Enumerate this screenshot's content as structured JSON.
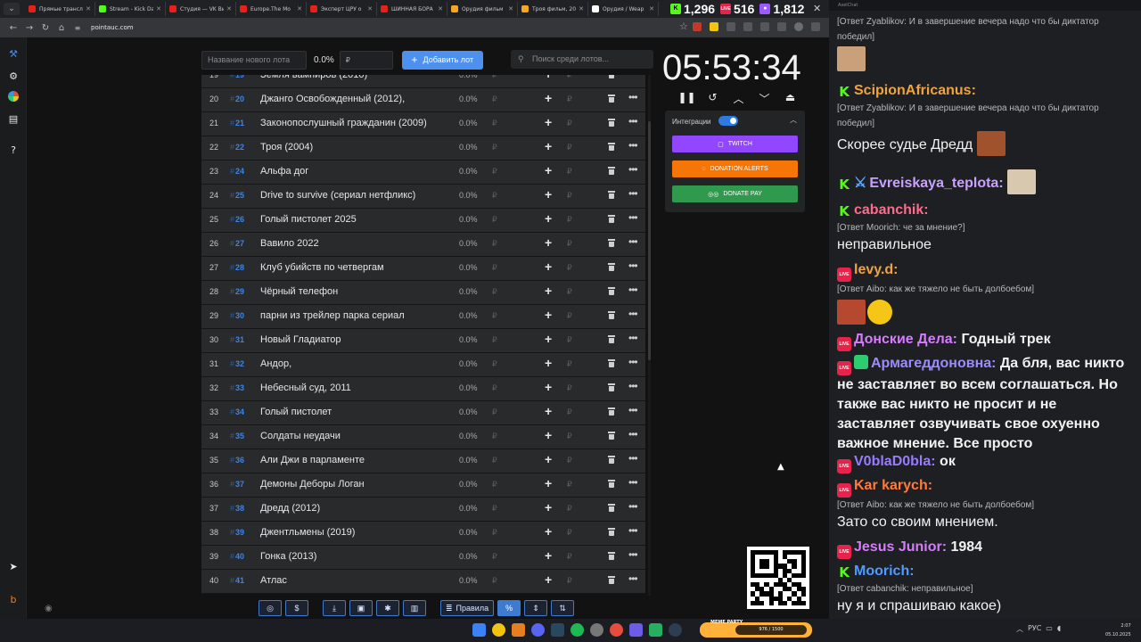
{
  "browser": {
    "tabs": [
      {
        "label": "Прямые трансл",
        "color": "#e62117"
      },
      {
        "label": "Stream - Kick Da",
        "color": "#53fc18"
      },
      {
        "label": "Студия — VK Ви",
        "color": "#e62117"
      },
      {
        "label": "Europe.The Mo",
        "color": "#e62117"
      },
      {
        "label": "Эксперт ЦРУ о",
        "color": "#e62117"
      },
      {
        "label": "ШИННАЯ БОРА",
        "color": "#e62117"
      },
      {
        "label": "Орудия фильм",
        "color": "#f5a623"
      },
      {
        "label": "Троя фильм, 20",
        "color": "#f5a623"
      },
      {
        "label": "Орудия / Weap",
        "color": "#ffffff"
      }
    ],
    "url": "pointauc.com",
    "viewer_stats": [
      {
        "platform": "K",
        "count": "1,296",
        "color": "#53fc18"
      },
      {
        "platform": "LIVE",
        "count": "516",
        "color": "#e6244b"
      },
      {
        "platform": "",
        "count": "1,812",
        "color": "#9b59ff"
      }
    ]
  },
  "auction": {
    "new_lot_placeholder": "Название нового лота",
    "percent": "0.0%",
    "currency_placeholder": "₽",
    "add_button": "Добавить лот",
    "search_placeholder": "Поиск среди лотов...",
    "top_partial_row": {
      "num": "19",
      "id": "19",
      "name": "Земля вампиров (2010)"
    },
    "rows": [
      {
        "num": "20",
        "id": "20",
        "name": "Джанго Освобожденный (2012),",
        "pct": "0.0%"
      },
      {
        "num": "21",
        "id": "21",
        "name": "Законопослушный гражданин (2009)",
        "pct": "0.0%"
      },
      {
        "num": "22",
        "id": "22",
        "name": "Троя (2004)",
        "pct": "0.0%"
      },
      {
        "num": "23",
        "id": "24",
        "name": "Альфа дог",
        "pct": "0.0%"
      },
      {
        "num": "24",
        "id": "25",
        "name": "Drive to survive (сериал нетфликс)",
        "pct": "0.0%"
      },
      {
        "num": "25",
        "id": "26",
        "name": "Голый пистолет 2025",
        "pct": "0.0%"
      },
      {
        "num": "26",
        "id": "27",
        "name": "Вавило 2022",
        "pct": "0.0%"
      },
      {
        "num": "27",
        "id": "28",
        "name": "Клуб убийств по четвергам",
        "pct": "0.0%"
      },
      {
        "num": "28",
        "id": "29",
        "name": "Чёрный телефон",
        "pct": "0.0%"
      },
      {
        "num": "29",
        "id": "30",
        "name": "парни из трейлер парка сериал",
        "pct": "0.0%"
      },
      {
        "num": "30",
        "id": "31",
        "name": "Новый Гладиатор",
        "pct": "0.0%"
      },
      {
        "num": "31",
        "id": "32",
        "name": "Андор,",
        "pct": "0.0%"
      },
      {
        "num": "32",
        "id": "33",
        "name": "Небесный суд, 2011",
        "pct": "0.0%"
      },
      {
        "num": "33",
        "id": "34",
        "name": "Голый пистолет",
        "pct": "0.0%"
      },
      {
        "num": "34",
        "id": "35",
        "name": "Солдаты неудачи",
        "pct": "0.0%"
      },
      {
        "num": "35",
        "id": "36",
        "name": "Али Джи в парламенте",
        "pct": "0.0%"
      },
      {
        "num": "36",
        "id": "37",
        "name": "Демоны Деборы Логан",
        "pct": "0.0%"
      },
      {
        "num": "37",
        "id": "38",
        "name": "Дредд (2012)",
        "pct": "0.0%"
      },
      {
        "num": "38",
        "id": "39",
        "name": "Джентльмены (2019)",
        "pct": "0.0%"
      },
      {
        "num": "39",
        "id": "40",
        "name": "Гонка (2013)",
        "pct": "0.0%"
      },
      {
        "num": "40",
        "id": "41",
        "name": "Атлас",
        "pct": "0.0%"
      }
    ],
    "currency_symbol": "₽",
    "timer": "05:53:34",
    "integrations_label": "Интеграции",
    "integrations": [
      {
        "label": "TWITCH",
        "color": "#9146ff"
      },
      {
        "label": "DONATION ALERTS",
        "color": "#f57507"
      },
      {
        "label": "DONATE PAY",
        "color": "#2f9a4e"
      }
    ],
    "bottom_rules": "Правила",
    "bottom_percent": "%"
  },
  "chat": {
    "window_title": "AxelChat",
    "messages": [
      {
        "platform": "",
        "user": "",
        "color": "",
        "reply": "[Ответ Zyablikov: И в завершение вечера надо что бы диктатор победил]",
        "text": ""
      },
      {
        "platform": "K",
        "user": "ScipionAfricanus:",
        "color": "#f0a43c",
        "reply": "[Ответ Zyablikov: И в завершение вечера надо что бы диктатор победил]",
        "text": "Скорее судье Дредд"
      },
      {
        "platform": "K",
        "user": "Evreiskaya_teplota:",
        "color": "#c8a2ff",
        "reply": "",
        "text": ""
      },
      {
        "platform": "K",
        "user": "cabanchik:",
        "color": "#ff6b8f",
        "reply": "[Ответ Moorich: че за мнение?]",
        "text": "неправильное"
      },
      {
        "platform": "LIVE",
        "user": "levy.d:",
        "color": "#f0a43c",
        "reply": "[Ответ Aibo: как же тяжело не быть долбоебом]",
        "text": ""
      },
      {
        "platform": "LIVE",
        "user": "Донские Дела:",
        "color": "#d77bff",
        "reply": "",
        "text": "Годный трек"
      },
      {
        "platform": "LIVE",
        "user": "Армагеддоновна:",
        "color": "#9a8cff",
        "reply": "",
        "text": "Да бля, вас никто не заставляет во всем соглашаться. Но также вас никто не просит и не заставляет озвучивать свое охуенно важное мнение. Все просто"
      },
      {
        "platform": "LIVE",
        "user": "V0blaD0bla:",
        "color": "#9a7bff",
        "reply": "",
        "text": "ок"
      },
      {
        "platform": "LIVE",
        "user": "Kar karych:",
        "color": "#ff7a3c",
        "reply": "[Ответ Aibo: как же тяжело не быть долбоебом]",
        "text": "Зато со своим мнением."
      },
      {
        "platform": "LIVE",
        "user": "Jesus Junior:",
        "color": "#d77bff",
        "reply": "",
        "text": "1984"
      },
      {
        "platform": "K",
        "user": "Moorich:",
        "color": "#4f9bff",
        "reply": "[Ответ cabanchik: неправильное]",
        "text": "ну я и спрашиваю какое)"
      }
    ]
  },
  "taskbar": {
    "meter_label": "MEME PARTY",
    "meter_value": "976 / 1500",
    "lang": "РУС",
    "time": "2:07",
    "date": "05.10.2025"
  }
}
